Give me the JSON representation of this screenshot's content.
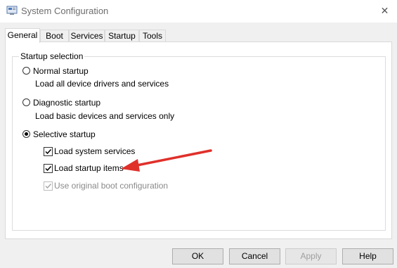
{
  "window": {
    "title": "System Configuration",
    "close_glyph": "✕"
  },
  "tabs": [
    {
      "label": "General",
      "active": true
    },
    {
      "label": "Boot",
      "active": false
    },
    {
      "label": "Services",
      "active": false
    },
    {
      "label": "Startup",
      "active": false
    },
    {
      "label": "Tools",
      "active": false
    }
  ],
  "startup_selection": {
    "group_label": "Startup selection",
    "normal": {
      "label": "Normal startup",
      "description": "Load all device drivers and services",
      "selected": false
    },
    "diagnostic": {
      "label": "Diagnostic startup",
      "description": "Load basic devices and services only",
      "selected": false
    },
    "selective": {
      "label": "Selective startup",
      "selected": true,
      "options": [
        {
          "label": "Load system services",
          "checked": true,
          "enabled": true
        },
        {
          "label": "Load startup items",
          "checked": true,
          "enabled": true
        },
        {
          "label": "Use original boot configuration",
          "checked": true,
          "enabled": false
        }
      ]
    }
  },
  "annotation": {
    "arrow_color": "#e0302a"
  },
  "buttons": {
    "ok": "OK",
    "cancel": "Cancel",
    "apply": "Apply",
    "help": "Help"
  }
}
